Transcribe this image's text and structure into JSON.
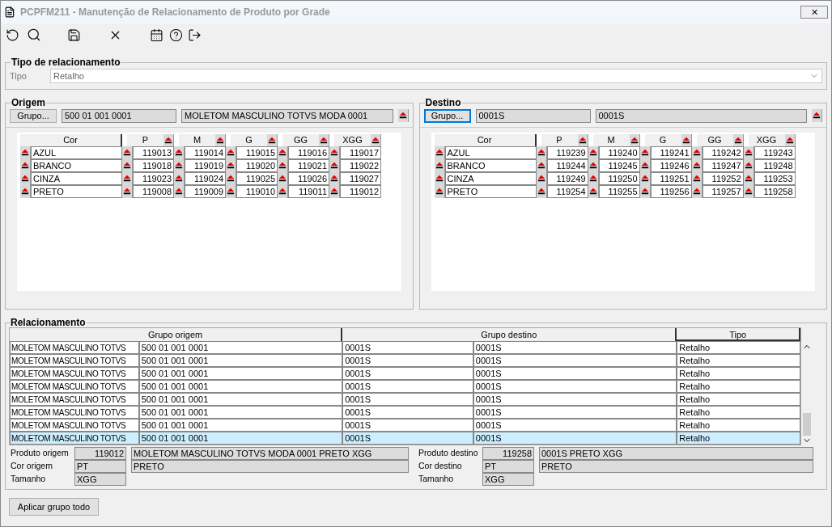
{
  "window": {
    "title": "PCPFM211 - Manutenção de Relacionamento de Produto por Grade",
    "close": "✕"
  },
  "tipo_section": {
    "legend": "Tipo de relacionamento",
    "label": "Tipo",
    "value": "Retalho"
  },
  "origem": {
    "legend": "Origem",
    "button": "Grupo...",
    "focused": false,
    "code": "500 01 001 0001",
    "description": "MOLETOM MASCULINO TOTVS MODA 0001",
    "grid": {
      "columns": [
        "Cor",
        "P",
        "M",
        "G",
        "GG",
        "XGG"
      ],
      "rows": [
        {
          "cor": "AZUL",
          "values": [
            "119013",
            "119014",
            "119015",
            "119016",
            "119017"
          ]
        },
        {
          "cor": "BRANCO",
          "values": [
            "119018",
            "119019",
            "119020",
            "119021",
            "119022"
          ]
        },
        {
          "cor": "CINZA",
          "values": [
            "119023",
            "119024",
            "119025",
            "119026",
            "119027"
          ]
        },
        {
          "cor": "PRETO",
          "values": [
            "119008",
            "119009",
            "119010",
            "119011",
            "119012"
          ]
        }
      ]
    }
  },
  "destino": {
    "legend": "Destino",
    "button": "Grupo...",
    "focused": true,
    "code": "0001S",
    "description": "0001S",
    "grid": {
      "columns": [
        "Cor",
        "P",
        "M",
        "G",
        "GG",
        "XGG"
      ],
      "rows": [
        {
          "cor": "AZUL",
          "values": [
            "119239",
            "119240",
            "119241",
            "119242",
            "119243"
          ]
        },
        {
          "cor": "BRANCO",
          "values": [
            "119244",
            "119245",
            "119246",
            "119247",
            "119248"
          ]
        },
        {
          "cor": "CINZA",
          "values": [
            "119249",
            "119250",
            "119251",
            "119252",
            "119253"
          ]
        },
        {
          "cor": "PRETO",
          "values": [
            "119254",
            "119255",
            "119256",
            "119257",
            "119258"
          ]
        }
      ]
    }
  },
  "relacionamento": {
    "legend": "Relacionamento",
    "columns": [
      "Grupo origem",
      "Grupo destino",
      "Tipo"
    ],
    "rows": [
      {
        "origin_name": "MOLETOM MASCULINO TOTVS",
        "origin_code": "500 01 001 0001",
        "dest_code": "0001S",
        "dest_name": "0001S",
        "tipo": "Retalho",
        "selected": false
      },
      {
        "origin_name": "MOLETOM MASCULINO TOTVS",
        "origin_code": "500 01 001 0001",
        "dest_code": "0001S",
        "dest_name": "0001S",
        "tipo": "Retalho",
        "selected": false
      },
      {
        "origin_name": "MOLETOM MASCULINO TOTVS",
        "origin_code": "500 01 001 0001",
        "dest_code": "0001S",
        "dest_name": "0001S",
        "tipo": "Retalho",
        "selected": false
      },
      {
        "origin_name": "MOLETOM MASCULINO TOTVS",
        "origin_code": "500 01 001 0001",
        "dest_code": "0001S",
        "dest_name": "0001S",
        "tipo": "Retalho",
        "selected": false
      },
      {
        "origin_name": "MOLETOM MASCULINO TOTVS",
        "origin_code": "500 01 001 0001",
        "dest_code": "0001S",
        "dest_name": "0001S",
        "tipo": "Retalho",
        "selected": false
      },
      {
        "origin_name": "MOLETOM MASCULINO TOTVS",
        "origin_code": "500 01 001 0001",
        "dest_code": "0001S",
        "dest_name": "0001S",
        "tipo": "Retalho",
        "selected": false
      },
      {
        "origin_name": "MOLETOM MASCULINO TOTVS",
        "origin_code": "500 01 001 0001",
        "dest_code": "0001S",
        "dest_name": "0001S",
        "tipo": "Retalho",
        "selected": false
      },
      {
        "origin_name": "MOLETOM MASCULINO TOTVS",
        "origin_code": "500 01 001 0001",
        "dest_code": "0001S",
        "dest_name": "0001S",
        "tipo": "Retalho",
        "selected": true
      }
    ],
    "details": [
      {
        "rows": [
          {
            "label": "Produto origem",
            "code": "119012",
            "description": "MOLETOM MASCULINO TOTVS MODA 0001 PRETO XGG"
          },
          {
            "label": "Cor origem",
            "code": "PT",
            "description": "PRETO"
          },
          {
            "label": "Tamanho",
            "code": "XGG"
          }
        ]
      },
      {
        "rows": [
          {
            "label": "Produto destino",
            "code": "119258",
            "description": "0001S PRETO XGG"
          },
          {
            "label": "Cor destino",
            "code": "PT",
            "description": "PRETO"
          },
          {
            "label": "Tamanho",
            "code": "XGG"
          }
        ]
      }
    ]
  },
  "apply_button": "Aplicar grupo todo"
}
